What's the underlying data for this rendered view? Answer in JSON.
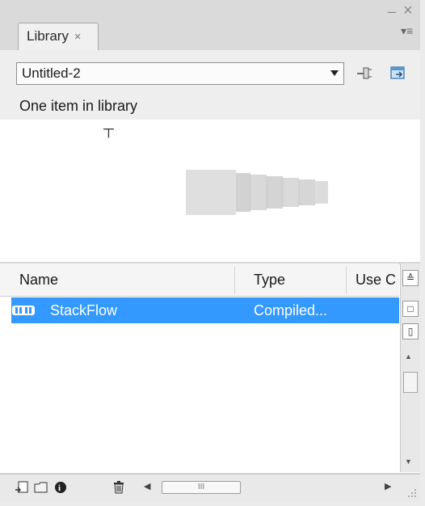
{
  "panel": {
    "tab_label": "Library",
    "tab_close": "×",
    "window_minimize": "–",
    "window_close": "×",
    "menu_glyph": "▾≡"
  },
  "document_selector": {
    "value": "Untitled-2"
  },
  "library": {
    "item_count_text": "One item in library"
  },
  "columns": {
    "name": "Name",
    "type": "Type",
    "use_count": "Use C"
  },
  "items": [
    {
      "name": "StackFlow",
      "type": "Compiled...",
      "icon": "compiled-clip-icon"
    }
  ],
  "scrollbar": {
    "sort_glyph": "≙"
  },
  "hscroll": {
    "thumb_glyph": "III"
  },
  "colors": {
    "selection": "#3399ff",
    "panel_bg": "#d8d8d8"
  }
}
